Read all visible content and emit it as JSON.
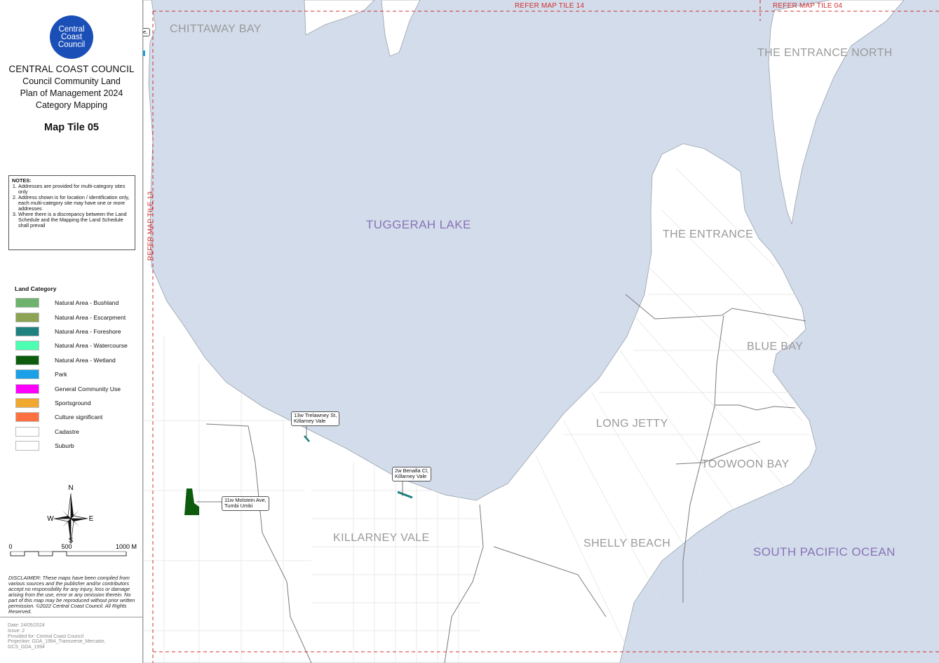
{
  "logo": {
    "line1": "Central",
    "line2": "Coast",
    "line3": "Council"
  },
  "title": {
    "council": "CENTRAL COAST COUNCIL",
    "line2": "Council Community Land",
    "line3": "Plan of Management 2024",
    "line4": "Category Mapping"
  },
  "map_tile": "Map Tile 05",
  "notes": {
    "heading": "NOTES:",
    "items": [
      "Addresses are provided for multi-category sites only",
      "Address shown is for location / identification only, each multi-category site may have one or more addresses",
      "Where there is a discrepancy between the Land Schedule and the Mapping the Land Schedule shall prevail"
    ]
  },
  "legend": {
    "title": "Land Category",
    "items": [
      {
        "label": "Natural Area - Bushland",
        "color": "#6db36d"
      },
      {
        "label": "Natural Area - Escarpment",
        "color": "#8ba352"
      },
      {
        "label": "Natural Area - Foreshore",
        "color": "#1f8080"
      },
      {
        "label": "Natural Area - Watercourse",
        "color": "#4dffb0"
      },
      {
        "label": "Natural Area - Wetland",
        "color": "#0d5c0d"
      },
      {
        "label": "Park",
        "color": "#19a0e6"
      },
      {
        "label": "General Community Use",
        "color": "#ff00ff"
      },
      {
        "label": "Sportsground",
        "color": "#f0a830"
      },
      {
        "label": "Culture significant",
        "color": "#ff7040"
      },
      {
        "label": "Cadastre",
        "color": "#ffffff"
      },
      {
        "label": "Suburb",
        "color": "#ffffff"
      }
    ]
  },
  "compass": {
    "n": "N",
    "s": "S",
    "e": "E",
    "w": "W"
  },
  "scale": {
    "zero": "0",
    "mid": "500",
    "max": "1000 M"
  },
  "disclaimer": "DISCLAIMER: These maps have been compiled from various sources and the publisher and/or contributors accept no responsibility for any injury, loss or damage arising from the use, error or any omission therein. No part of this map may be reproduced without prior written permission. ©2022 Central Coast Council. All Rights Reserved.",
  "meta": {
    "date": "Date: 24/05/2024",
    "issue": "Issue: 2",
    "provided": "Provided for: Central Coast Council",
    "projection": "Projection: GDA_1994_Transverse_Mercator,",
    "gcs": "GCS_GDA_1994"
  },
  "refer_labels": {
    "top_left": "REFER MAP TILE 14",
    "top_right": "REFER MAP TILE 04",
    "left": "REFER MAP TILE 13"
  },
  "places": {
    "chittaway_bay": "CHITTAWAY BAY",
    "entrance_north": "THE ENTRANCE NORTH",
    "the_entrance": "THE ENTRANCE",
    "blue_bay": "BLUE BAY",
    "long_jetty": "LONG JETTY",
    "toowoon_bay": "TOOWOON BAY",
    "killarney_vale": "KILLARNEY VALE",
    "shelly_beach": "SHELLY BEACH"
  },
  "water": {
    "tuggerah_lake": "TUGGERAH LAKE",
    "pacific": "SOUTH PACIFIC OCEAN"
  },
  "callouts": {
    "trelawney": {
      "line1": "13w Trelawney St,",
      "line2": "Killarney Vale"
    },
    "benalla": {
      "line1": "2w Benalla Cl,",
      "line2": "Killarney Vale"
    },
    "molstein": {
      "line1": "11w Molstein Ave,",
      "line2": "Tumbi Umbi"
    },
    "edge_top": "e,"
  },
  "colors": {
    "water": "#d2dcea",
    "land": "#ffffff",
    "suburb_line": "#7a7a7a",
    "refer_line": "#d03030"
  }
}
